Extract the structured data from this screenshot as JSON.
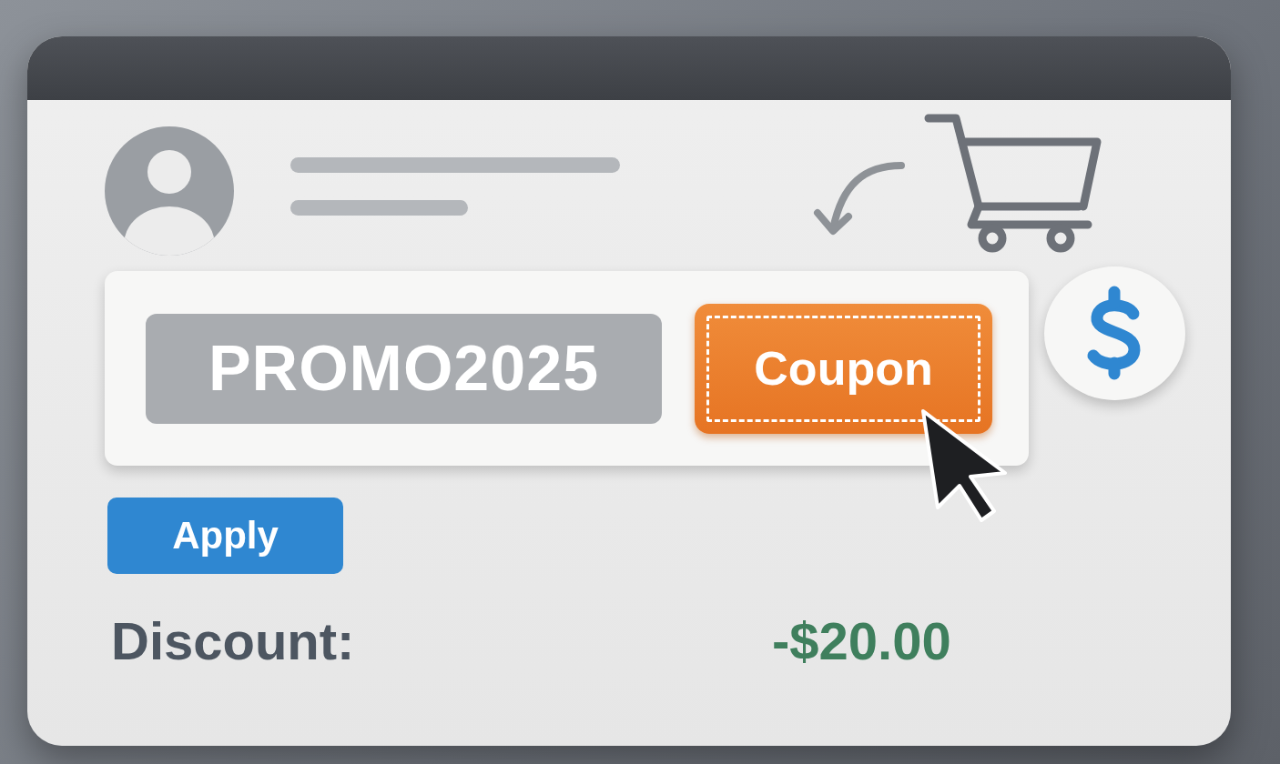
{
  "promo_code": {
    "value": "PROMO2025"
  },
  "coupon_button": {
    "label": "Coupon"
  },
  "apply_button": {
    "label": "Apply"
  },
  "discount": {
    "label": "Discount:",
    "amount": "-$20.00"
  }
}
